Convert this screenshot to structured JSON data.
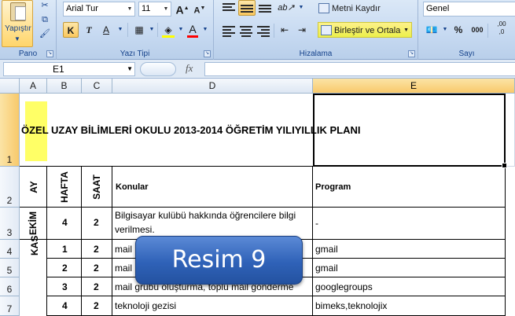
{
  "ribbon": {
    "groups": {
      "pano": "Pano",
      "yazi_tipi": "Yazı Tipi",
      "hizalama": "Hizalama",
      "sayi": "Sayı"
    },
    "paste_label": "Yapıştır",
    "font_name": "Arial Tur",
    "font_size": "11",
    "grow_font": "A",
    "shrink_font": "A",
    "bold": "K",
    "italic": "T",
    "underline": "A",
    "font_color_glyph": "A",
    "wrap_text": "Metni Kaydır",
    "merge_center": "Birleştir ve Ortala",
    "number_format": "Genel",
    "percent": "%",
    "comma": "000",
    "decimals": ",00\n,0",
    "accent_color": "#15428b",
    "font_color_bar": "#ff0000"
  },
  "formula_bar": {
    "name_box": "E1",
    "fx": "fx",
    "content": ""
  },
  "columns": [
    "A",
    "B",
    "C",
    "D",
    "E"
  ],
  "selected_column": "E",
  "rows": [
    "1",
    "2",
    "3",
    "4",
    "5",
    "6",
    "7"
  ],
  "selected_row": "1",
  "sheet": {
    "title": "ÖZEL UZAY BİLİMLERİ OKULU 2013-2014 ÖĞRETİM YILIYILLIK PLANI",
    "headers": {
      "ay": "AY",
      "hafta": "HAFTA",
      "saat": "SAAT",
      "konular": "Konular",
      "program": "Program"
    },
    "month_ekim": "EKİM",
    "month_kasim_partial": "KAS",
    "data": [
      {
        "hafta": "4",
        "saat": "2",
        "konu_line1": "Bilgisayar kulübü hakkında öğrencilere bilgi",
        "konu_line2": "verilmesi.",
        "program": "-"
      },
      {
        "hafta": "1",
        "saat": "2",
        "konu_line1": "mail",
        "program": "gmail"
      },
      {
        "hafta": "2",
        "saat": "2",
        "konu_line1": "mail",
        "program": "gmail"
      },
      {
        "hafta": "3",
        "saat": "2",
        "konu_line1": "mail grubu oluşturma, toplu mail gönderme",
        "program": "googlegroups"
      },
      {
        "hafta": "4",
        "saat": "2",
        "konu_line1": "teknoloji gezisi",
        "program": "bimeks,teknolojix"
      }
    ]
  },
  "overlay": {
    "label": "Resim 9"
  }
}
